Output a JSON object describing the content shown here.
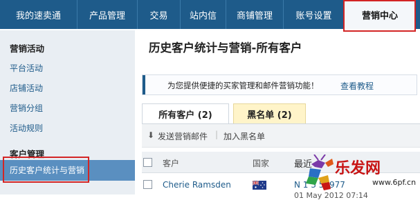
{
  "topnav": {
    "tabs": [
      {
        "label": "我的速卖通",
        "active": false
      },
      {
        "label": "产品管理",
        "active": false
      },
      {
        "label": "交易",
        "active": false
      },
      {
        "label": "站内信",
        "active": false
      },
      {
        "label": "商铺管理",
        "active": false
      },
      {
        "label": "账号设置",
        "active": false
      },
      {
        "label": "营销中心",
        "active": true
      }
    ]
  },
  "sidebar": {
    "section_marketing": "营销活动",
    "marketing_items": [
      "平台活动",
      "店铺活动",
      "营销分组",
      "活动规则"
    ],
    "section_customer": "客户管理",
    "customer_items": [
      "历史客户统计与营销"
    ]
  },
  "main": {
    "title": "历史客户统计与营销-所有客户",
    "notice_text": "为您提供便捷的买家管理和邮件营销功能！",
    "notice_link": "查看教程",
    "tabs": [
      "所有客户 (2)",
      "黑名单 (2)"
    ],
    "toolbar": {
      "send": "发送营销邮件",
      "blacklist": "加入黑名单"
    },
    "table": {
      "headers": {
        "customer": "客户",
        "country": "国家",
        "last": "最近"
      },
      "rows": [
        {
          "name": "Cherie Ramsden",
          "date": "N 1 3 59977",
          "date2": "01 May 2012 07:14"
        }
      ]
    }
  },
  "watermark": {
    "logo": "乐发网",
    "url": "www.6pf.cn"
  },
  "colors": {
    "nav": "#1e5b8a",
    "highlight": "#d32424",
    "sidebar_active": "#5a8fc0",
    "tab_yellow": "#fff4c9"
  }
}
